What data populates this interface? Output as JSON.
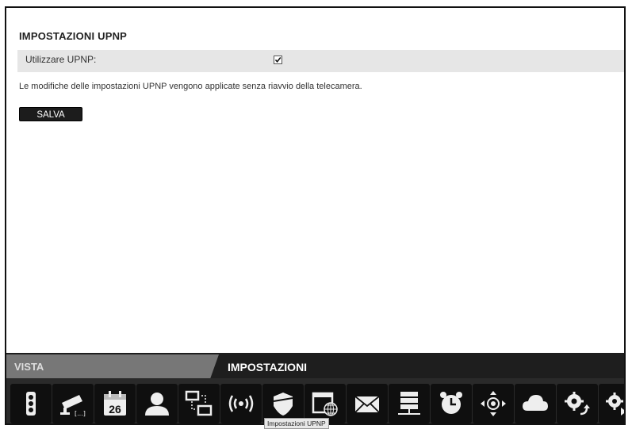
{
  "page": {
    "title": "IMPOSTAZIONI UPNP",
    "row_label": "Utilizzare UPNP:",
    "upnp_enabled": true,
    "note": "Le modifiche delle impostazioni UPNP vengono applicate senza riavvio della telecamera.",
    "save_label": "SALVA"
  },
  "tabs": [
    {
      "label": "VISTA",
      "active": false
    },
    {
      "label": "IMPOSTAZIONI",
      "active": true
    }
  ],
  "toolbar": {
    "icons": [
      "status-light-icon",
      "camera-icon",
      "calendar-icon",
      "user-icon",
      "network-icon",
      "wireless-icon",
      "shield-icon",
      "upnp-globe-icon",
      "mail-icon",
      "server-icon",
      "alarm-clock-icon",
      "ptz-control-icon",
      "cloud-icon",
      "settings-restore-icon",
      "settings-next-icon"
    ],
    "calendar_day": "26",
    "camera_caption": "[...]",
    "tooltip": "Impostazioni UPNP"
  }
}
